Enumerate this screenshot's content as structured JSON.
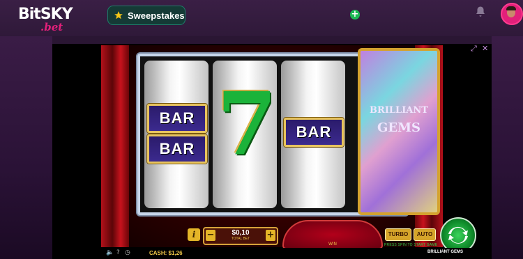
{
  "header": {
    "logo_text_top": "BitSKY",
    "logo_text_bottom": ".bet",
    "sweepstakes_label": "Sweepstakes",
    "add_icon": "plus-circle-icon",
    "notification_icon": "bell-icon",
    "avatar_icon": "user-avatar"
  },
  "game": {
    "window_controls": [
      "fullscreen-icon",
      "close-icon"
    ],
    "reels": {
      "reel1": [
        "BAR",
        "BAR"
      ],
      "reel2": [
        "7"
      ],
      "reel3": [
        "BAR"
      ],
      "reel4_title_line1": "BRILLIANT",
      "reel4_title_line2": "GEMS"
    },
    "controls": {
      "info_label": "i",
      "minus_label": "−",
      "plus_label": "+",
      "bet_value": "$0,10",
      "bet_label": "TOTAL BET",
      "win_label": "WIN",
      "turbo_label": "TURBO",
      "auto_label": "AUTO",
      "prompt": "PRESS SPIN TO START GAME"
    },
    "status": {
      "sound_icon": "speaker-icon",
      "help_label": "?",
      "history_icon": "clock-icon",
      "cash_text": "CASH:  $1,26",
      "game_name": "BRILLIANT GEMS"
    }
  },
  "colors": {
    "accent_pink": "#e2207a",
    "sweep_green": "#1e7d6a",
    "spin_green": "#0f8a2a",
    "gold": "#d7a23a"
  }
}
